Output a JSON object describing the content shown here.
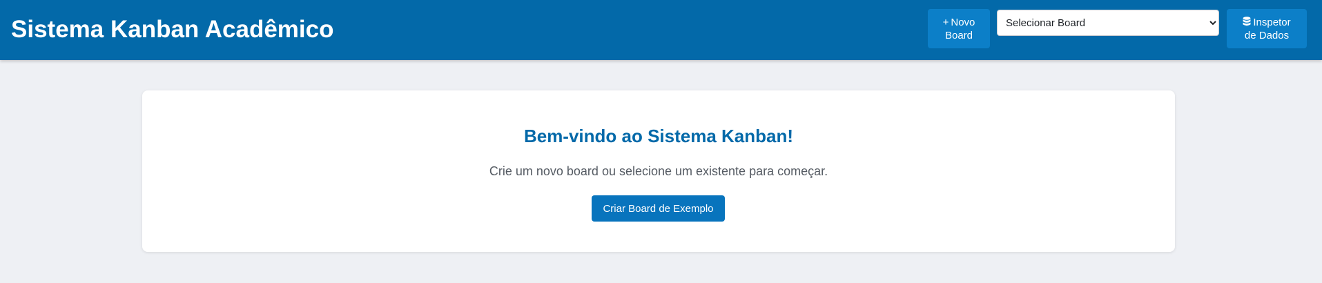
{
  "header": {
    "title": "Sistema Kanban Acadêmico",
    "new_board": {
      "icon": "plus-icon",
      "glyph": "+",
      "label_line1": "Novo",
      "label_line2": "Board"
    },
    "board_select": {
      "selected": "Selecionar Board"
    },
    "inspector": {
      "icon": "database-icon",
      "label_line1": "Inspetor",
      "label_line2": "de Dados"
    }
  },
  "welcome": {
    "title": "Bem-vindo ao Sistema Kanban!",
    "subtitle": "Crie um novo board ou selecione um existente para começar.",
    "button_label": "Criar Board de Exemplo"
  },
  "colors": {
    "header_bg": "#0369a9",
    "header_button": "#0c7fc8",
    "accent": "#0874bd",
    "page_bg": "#eef0f4"
  }
}
